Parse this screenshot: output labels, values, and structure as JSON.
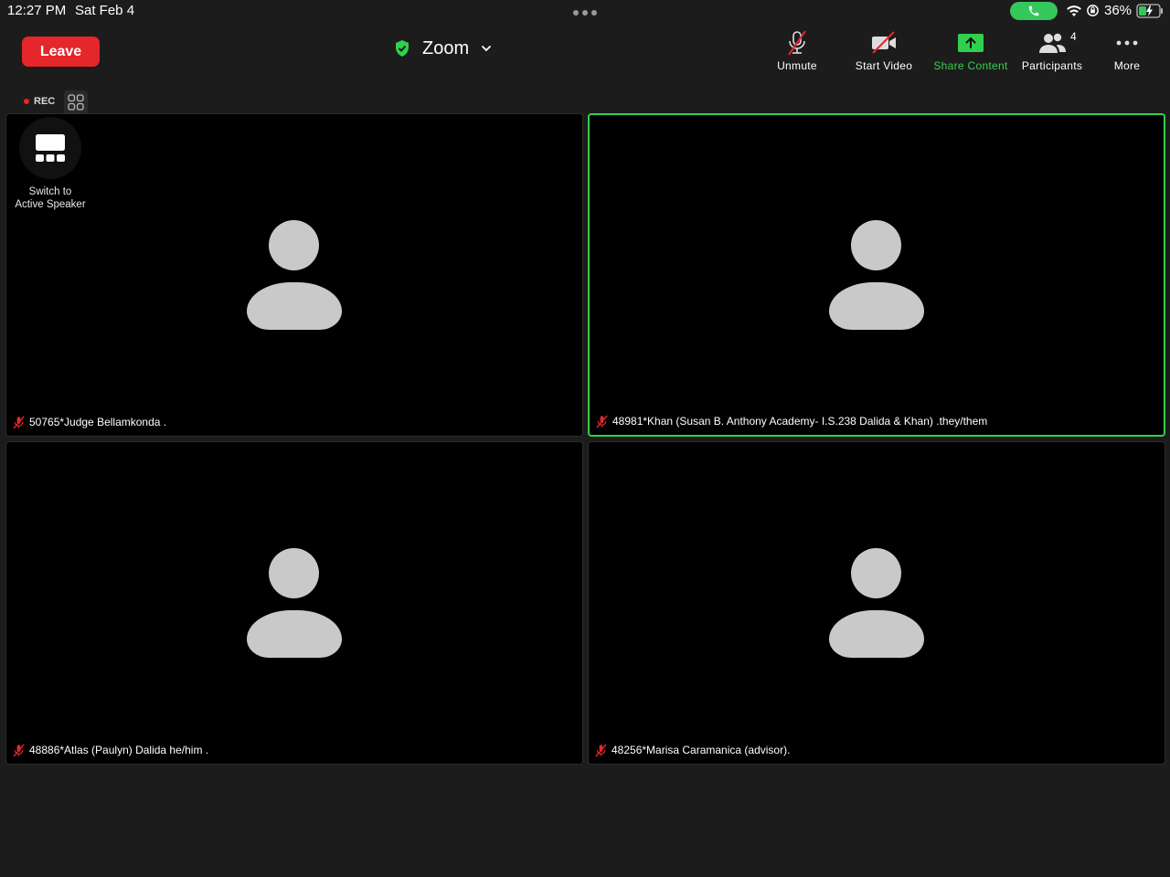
{
  "status_bar": {
    "time": "12:27 PM",
    "date": "Sat Feb 4",
    "battery": "36%",
    "call_color": "#34c759"
  },
  "toolbar": {
    "leave_label": "Leave",
    "title": "Zoom",
    "unmute_label": "Unmute",
    "start_video_label": "Start Video",
    "share_label": "Share Content",
    "participants_label": "Participants",
    "participants_count": "4",
    "more_label": "More",
    "leave_color": "#e5262b",
    "accent_color": "#38d150"
  },
  "recording": {
    "label": "REC"
  },
  "switch_view": {
    "label_line1": "Switch to",
    "label_line2": "Active Speaker"
  },
  "tiles": [
    {
      "name": "50765*Judge Bellamkonda .",
      "muted": true,
      "active": false
    },
    {
      "name": "48981*Khan (Susan B. Anthony Academy- I.S.238 Dalida & Khan) .they/them",
      "muted": true,
      "active": true
    },
    {
      "name": "48886*Atlas (Paulyn) Dalida he/him .",
      "muted": true,
      "active": false
    },
    {
      "name": "48256*Marisa Caramanica (advisor).",
      "muted": true,
      "active": false
    }
  ]
}
